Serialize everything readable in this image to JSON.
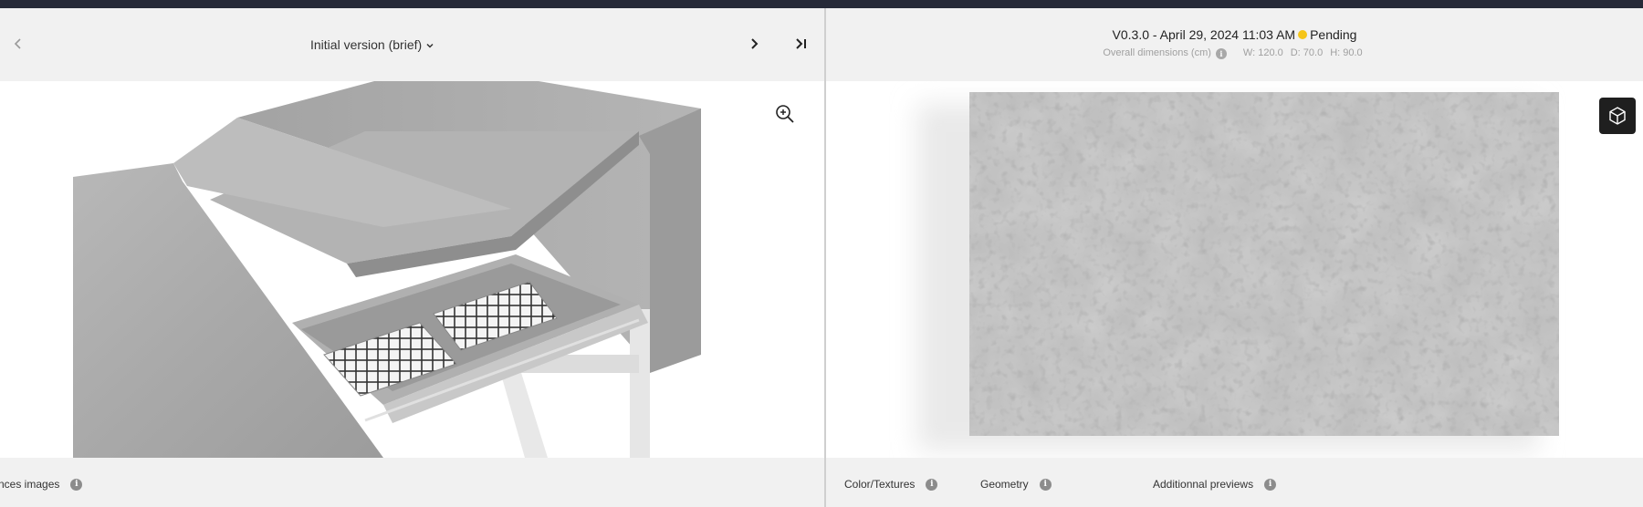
{
  "left": {
    "version_label": "Initial version (brief)",
    "footer_tab": "nces images"
  },
  "right": {
    "version_text": "V0.3.0 - April 29, 2024 11:03 AM",
    "status": "Pending",
    "status_color": "#f5c518",
    "dimensions_label": "Overall dimensions (cm)",
    "width": "W: 120.0",
    "depth": "D: 70.0",
    "height": "H: 90.0",
    "tabs": [
      "Color/Textures",
      "Geometry",
      "Additionnal previews"
    ]
  },
  "icons": {
    "prev": "chevron-left-icon",
    "dropdown": "chevron-down-icon",
    "next": "chevron-right-icon",
    "last": "skip-to-end-icon",
    "zoom": "zoom-in-icon",
    "info": "info-icon",
    "cube": "cube-icon"
  },
  "colors": {
    "topbar": "#262a38",
    "background": "#f1f1f1",
    "cube_button": "#1f1f1f"
  }
}
